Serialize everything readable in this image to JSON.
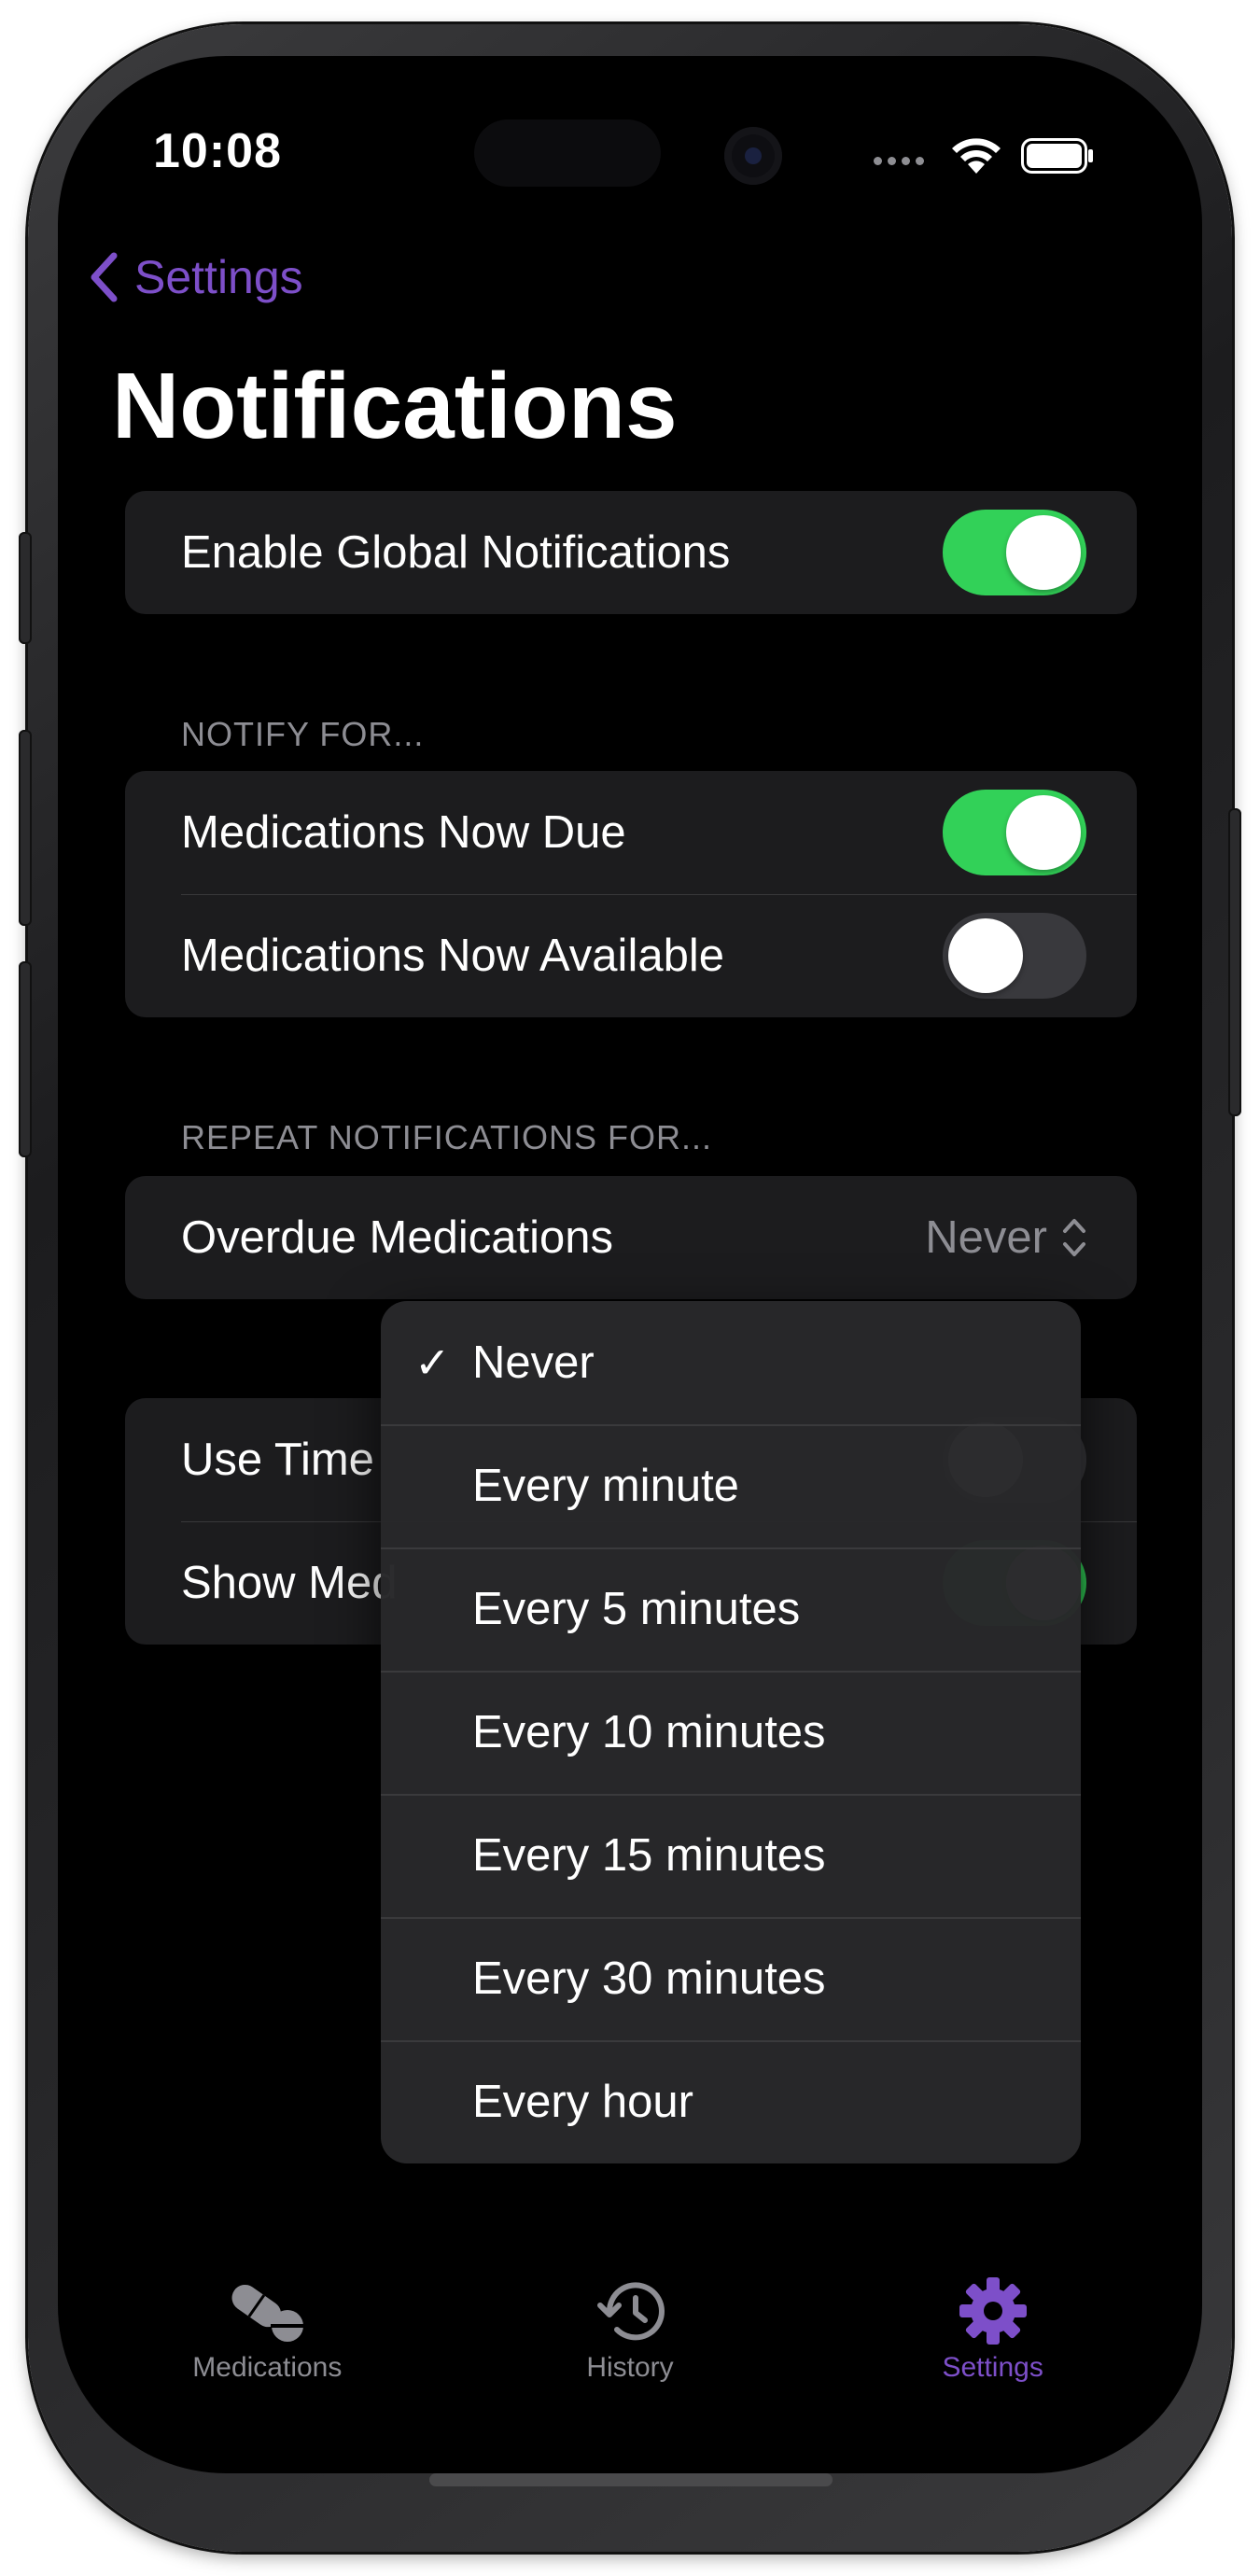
{
  "status_bar": {
    "time": "10:08"
  },
  "nav": {
    "back_label": "Settings",
    "title": "Notifications"
  },
  "global_group": {
    "enable_label": "Enable Global Notifications",
    "enable_on": true
  },
  "notify_for": {
    "header": "NOTIFY FOR...",
    "items": [
      {
        "label": "Medications Now Due",
        "on": true
      },
      {
        "label": "Medications Now Available",
        "on": false
      }
    ]
  },
  "repeat_for": {
    "header": "REPEAT NOTIFICATIONS FOR...",
    "overdue_label": "Overdue Medications",
    "overdue_value": "Never"
  },
  "other_group": {
    "items": [
      {
        "label": "Use Time"
      },
      {
        "label": "Show Med"
      }
    ]
  },
  "dropdown": {
    "selected": "Never",
    "check_glyph": "✓",
    "options": [
      "Never",
      "Every minute",
      "Every 5 minutes",
      "Every 10 minutes",
      "Every 15 minutes",
      "Every 30 minutes",
      "Every hour"
    ]
  },
  "tabbar": {
    "tabs": [
      {
        "label": "Medications",
        "icon": "pill-icon",
        "active": false
      },
      {
        "label": "History",
        "icon": "history-clock-icon",
        "active": false
      },
      {
        "label": "Settings",
        "icon": "gear-icon",
        "active": true
      }
    ]
  },
  "colors": {
    "accent": "#7d4fc9",
    "toggle_on": "#32d158",
    "toggle_off": "#39393d",
    "group_bg": "#1c1c1e"
  }
}
